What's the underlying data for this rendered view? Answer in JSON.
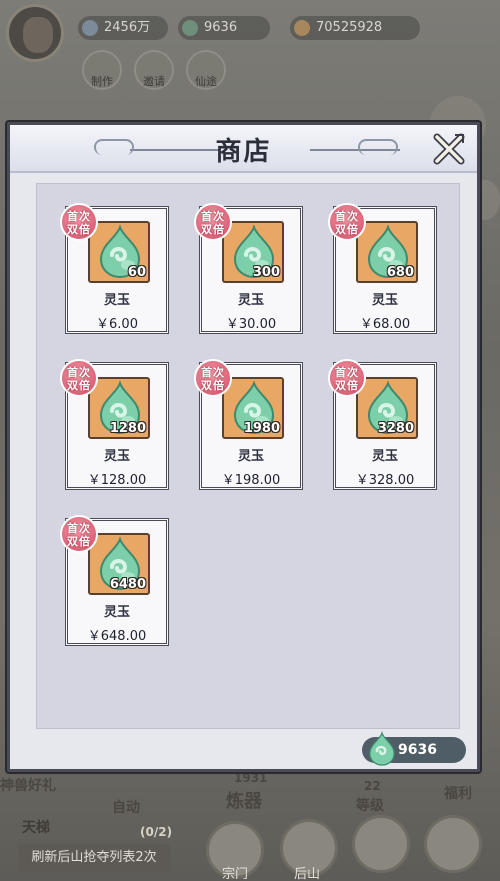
{
  "background": {
    "top": {
      "silver": "2456万",
      "jade": "9636",
      "gold": "70525928"
    },
    "top_buttons": [
      "制作",
      "邀请",
      "仙途"
    ],
    "bottom": {
      "gift_text": "神兽好礼",
      "auto_label": "自动",
      "count_1931": "1931",
      "refine_label": "炼器",
      "count_22": "22",
      "level_label": "等级",
      "welfare_label": "福利",
      "days_label": "天梯",
      "progress_text": "(0/2)",
      "refresh_text": "刷新后山抢夺列表2次",
      "nav_zongmen": "宗门",
      "nav_houshan": "后山"
    }
  },
  "shop": {
    "title": "商店",
    "badge_line1": "首次",
    "badge_line2": "双倍",
    "items": [
      {
        "name": "灵玉",
        "qty": "60",
        "price": "￥6.00"
      },
      {
        "name": "灵玉",
        "qty": "300",
        "price": "￥30.00"
      },
      {
        "name": "灵玉",
        "qty": "680",
        "price": "￥68.00"
      },
      {
        "name": "灵玉",
        "qty": "1280",
        "price": "￥128.00"
      },
      {
        "name": "灵玉",
        "qty": "1980",
        "price": "￥198.00"
      },
      {
        "name": "灵玉",
        "qty": "3280",
        "price": "￥328.00"
      },
      {
        "name": "灵玉",
        "qty": "6480",
        "price": "￥648.00"
      }
    ],
    "balance": "9636"
  },
  "icons": {
    "close": "close-x-icon",
    "gem": "jade-gem-icon"
  },
  "colors": {
    "badge": "#e06a7f",
    "item_bg": "#e9a766",
    "gem": "#7ccfa8",
    "panel": "#d4d5e0"
  }
}
